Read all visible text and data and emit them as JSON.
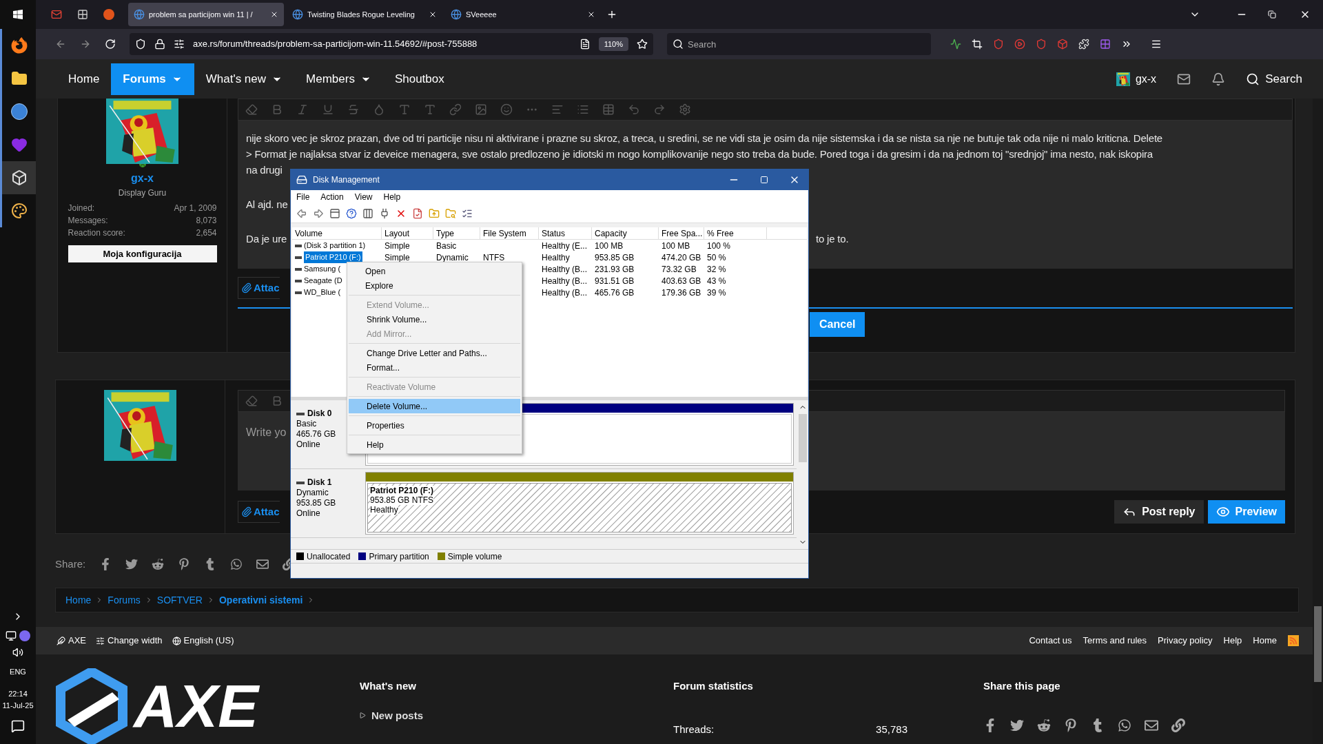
{
  "taskbar": {
    "language": "ENG",
    "time": "22:14",
    "date": "11-Jul-25"
  },
  "browser": {
    "tabs": [
      {
        "title": "problem sa particijom win 11 | /",
        "selected": true
      },
      {
        "title": "Twisting Blades Rogue Leveling",
        "selected": false
      },
      {
        "title": "SVeeeee",
        "selected": false
      }
    ],
    "url": "axe.rs/forum/threads/problem-sa-particijom-win-11.54692/#post-755888",
    "zoom": "110%",
    "search_placeholder": "Search"
  },
  "nav": {
    "items": [
      {
        "label": "Home",
        "selected": false,
        "dropdown": false
      },
      {
        "label": "Forums",
        "selected": true,
        "dropdown": true
      },
      {
        "label": "What's new",
        "selected": false,
        "dropdown": true
      },
      {
        "label": "Members",
        "selected": false,
        "dropdown": true
      },
      {
        "label": "Shoutbox",
        "selected": false,
        "dropdown": false
      }
    ],
    "user": "gx-x",
    "search": "Search"
  },
  "post": {
    "user": {
      "name": "gx-x",
      "title": "Display Guru",
      "stats": [
        {
          "label": "Joined:",
          "value": "Apr 1, 2009"
        },
        {
          "label": "Messages:",
          "value": "8,073"
        },
        {
          "label": "Reaction score:",
          "value": "2,654"
        }
      ],
      "config_button": "Moja konfiguracija"
    },
    "paragraph": [
      "nije skoro vec je skroz prazan, dve od tri particije nisu ni aktivirane i prazne su skroz, a treca, u sredini, se ne vidi sta je osim da nije sistemska i da se nista sa nje ne butuje tak oda nije ni malo kriticna. Delete",
      "> Format je najlaksa stvar iz deveice menagera, sve ostalo predlozeno je idiotski m nogo komplikovanije nego sto treba da bude. Pored toga i da gresim i da na jednom toj \"srednjoj\" ima nesto, nak iskopira",
      "na drugi"
    ],
    "line_2": "Al ajd. ne",
    "line_3_start": "Da je ure",
    "line_3_end": "to je to.",
    "attach": "Attac",
    "cancel": "Cancel"
  },
  "reply": {
    "placeholder": "Write yo",
    "attach": "Attac",
    "post_reply": "Post reply",
    "preview": "Preview"
  },
  "share": {
    "label": "Share:"
  },
  "breadcrumb": [
    {
      "label": "Home",
      "current": false
    },
    {
      "label": "Forums",
      "current": false
    },
    {
      "label": "SOFTVER",
      "current": false
    },
    {
      "label": "Operativni sistemi",
      "current": true
    }
  ],
  "footer": {
    "left": [
      "AXE",
      "Change width",
      "English (US)"
    ],
    "links": [
      "Contact us",
      "Terms and rules",
      "Privacy policy",
      "Help",
      "Home"
    ],
    "logo_text": "AXE",
    "whats_new": {
      "title": "What's new",
      "link": "New posts"
    },
    "stats": {
      "title": "Forum statistics",
      "label": "Threads:",
      "value": "35,783"
    },
    "share": {
      "title": "Share this page"
    }
  },
  "disk_management": {
    "title": "Disk Management",
    "menu": [
      "File",
      "Action",
      "View",
      "Help"
    ],
    "columns": [
      "Volume",
      "Layout",
      "Type",
      "File System",
      "Status",
      "Capacity",
      "Free Spa...",
      "% Free"
    ],
    "rows": [
      {
        "volume": "(Disk 3 partition 1)",
        "layout": "Simple",
        "type": "Basic",
        "status": "Healthy (E...",
        "capacity": "100 MB",
        "free": "100 MB",
        "pct": "100 %",
        "selected": false
      },
      {
        "volume": "Patriot P210 (F:)",
        "layout": "Simple",
        "type": "Dynamic",
        "fs": "NTFS",
        "status": "Healthy",
        "capacity": "953.85 GB",
        "free": "474.20 GB",
        "pct": "50 %",
        "selected": true
      },
      {
        "volume": "Samsung (",
        "status": "Healthy (B...",
        "capacity": "231.93 GB",
        "free": "73.32 GB",
        "pct": "32 %",
        "selected": false
      },
      {
        "volume": "Seagate (D",
        "status": "Healthy (B...",
        "capacity": "931.51 GB",
        "free": "403.63 GB",
        "pct": "43 %",
        "selected": false
      },
      {
        "volume": "WD_Blue (",
        "status": "Healthy (B...",
        "capacity": "465.76 GB",
        "free": "179.36 GB",
        "pct": "39 %",
        "selected": false
      }
    ],
    "context_menu": [
      [
        {
          "label": "Open",
          "disabled": false,
          "selected": false
        },
        {
          "label": "Explore",
          "disabled": false,
          "selected": false
        }
      ],
      [
        {
          "label": "Extend Volume...",
          "disabled": true,
          "selected": false
        },
        {
          "label": "Shrink Volume...",
          "disabled": false,
          "selected": false
        },
        {
          "label": "Add Mirror...",
          "disabled": true,
          "selected": false
        }
      ],
      [
        {
          "label": "Change Drive Letter and Paths...",
          "disabled": false,
          "selected": false
        },
        {
          "label": "Format...",
          "disabled": false,
          "selected": false
        }
      ],
      [
        {
          "label": "Reactivate Volume",
          "disabled": true,
          "selected": false
        }
      ],
      [
        {
          "label": "Delete Volume...",
          "disabled": false,
          "selected": true
        }
      ],
      [
        {
          "label": "Properties",
          "disabled": false,
          "selected": false
        }
      ],
      [
        {
          "label": "Help",
          "disabled": false,
          "selected": false
        }
      ]
    ],
    "disks": [
      {
        "name": "Disk 0",
        "type": "Basic",
        "size": "465.76 GB",
        "state": "Online",
        "partition": {
          "kind": "primary"
        }
      },
      {
        "name": "Disk 1",
        "type": "Dynamic",
        "size": "953.85 GB",
        "state": "Online",
        "partition": {
          "kind": "simple",
          "name": "Patriot P210  (F:)",
          "size": "953.85 GB NTFS",
          "status": "Healthy"
        }
      }
    ],
    "legend": [
      {
        "label": "Unallocated",
        "color": "#000000",
        "kind": "unallocated"
      },
      {
        "label": "Primary partition",
        "color": "#000080",
        "kind": "primary"
      },
      {
        "label": "Simple volume",
        "color": "#808000",
        "kind": "simple"
      }
    ]
  }
}
